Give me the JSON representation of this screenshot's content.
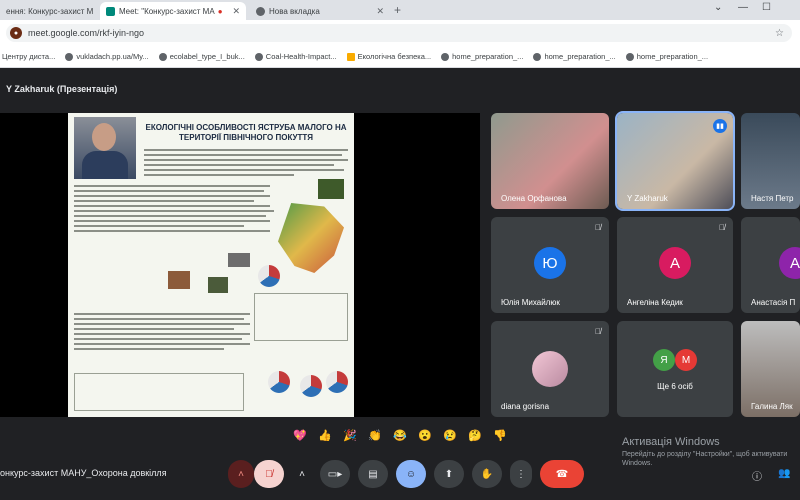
{
  "browser": {
    "tabs": [
      {
        "title": "ення: Конкурс-захист М",
        "active": false
      },
      {
        "title": "Meet: \"Конкурс-захист МА",
        "active": true
      },
      {
        "title": "Нова вкладка",
        "active": false
      }
    ],
    "new_tab": "+",
    "url": "meet.google.com/rkf-iyin-ngo",
    "bookmarks": [
      "Центру диста...",
      "vukladach.pp.ua/My...",
      "ecolabel_type_I_buk...",
      "Coal-Health-Impact...",
      "Екологічна безпека...",
      "home_preparation_...",
      "home_preparation_...",
      "home_preparation_..."
    ]
  },
  "meet": {
    "presenter_label": "Y Zakharuk (Презентація)",
    "slide": {
      "title": "ЕКОЛОГІЧНІ ОСОБЛИВОСТІ ЯСТРУБА МАЛОГО НА ТЕРИТОРІЇ ПІВНІЧНОГО ПОКУТТЯ"
    },
    "tiles": [
      {
        "name": "Олена Орфанова",
        "type": "camera"
      },
      {
        "name": "Y Zakharuk",
        "type": "camera",
        "speaking": true
      },
      {
        "name": "Настя Петр",
        "type": "camera"
      },
      {
        "name": "Юлія Михайлюк",
        "type": "avatar",
        "initial": "Ю",
        "color": "#1a73e8"
      },
      {
        "name": "Ангеліна Кедик",
        "type": "avatar",
        "initial": "А",
        "color": "#d81b60"
      },
      {
        "name": "Анастасія П",
        "type": "avatar",
        "initial": "А",
        "color": "#8e24aa"
      },
      {
        "name": "diana gorisna",
        "type": "photo"
      },
      {
        "name": "Ще 6 осіб",
        "type": "more",
        "initials": [
          "Я",
          "М"
        ]
      },
      {
        "name": "Галина Ляк",
        "type": "camera"
      }
    ],
    "reactions": [
      "💖",
      "👍",
      "🎉",
      "👏",
      "😂",
      "😮",
      "😢",
      "🤔",
      "👎"
    ],
    "meeting_name": "онкурс-захист МАНУ_Охорона довкілля",
    "activation": {
      "title": "Активація Windows",
      "subtitle": "Перейдіть до розділу \"Настройки\", щоб активувати Windows."
    }
  }
}
